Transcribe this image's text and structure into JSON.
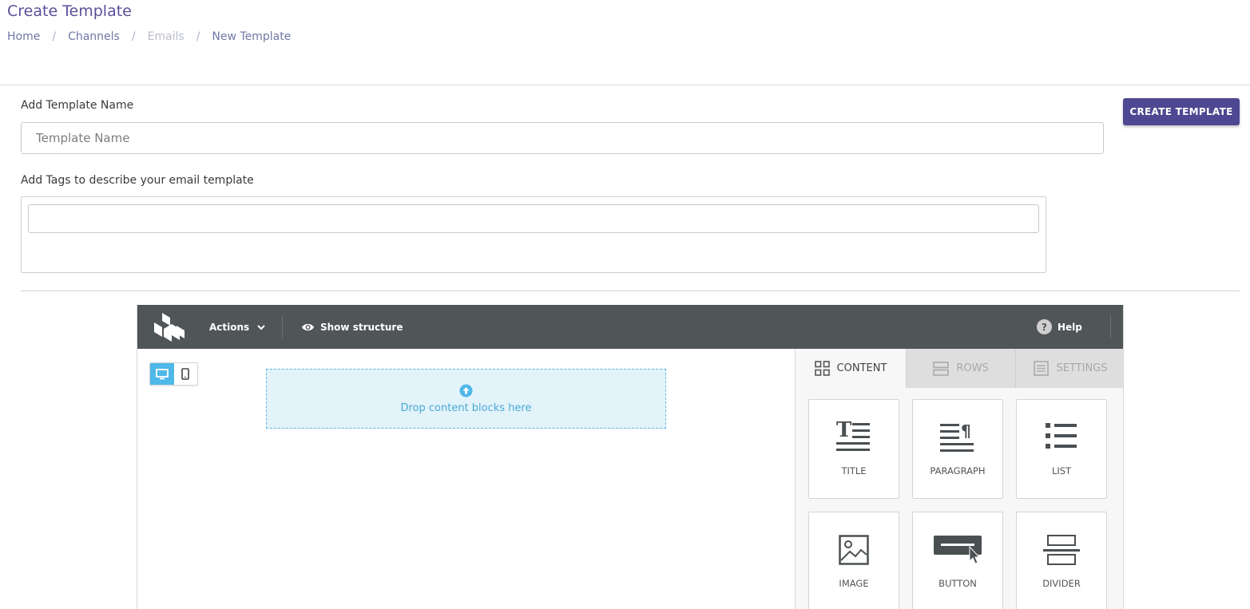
{
  "header": {
    "title": "Create Template",
    "breadcrumb": [
      "Home",
      "Channels",
      "Emails",
      "New Template"
    ],
    "separator": "/"
  },
  "form": {
    "name_label": "Add Template Name",
    "name_placeholder": "Template Name",
    "name_value": "",
    "tags_label": "Add Tags to describe your email template",
    "tags_value": "",
    "create_button": "CREATE TEMPLATE"
  },
  "editor": {
    "toolbar": {
      "actions_label": "Actions",
      "show_structure_label": "Show structure",
      "help_label": "Help",
      "help_glyph": "?"
    },
    "device_toggle": {
      "active": "desktop"
    },
    "drop_zone_text": "Drop content blocks here",
    "sidebar": {
      "tabs": [
        {
          "label": "CONTENT",
          "icon": "grid-icon",
          "active": true
        },
        {
          "label": "ROWS",
          "icon": "rows-icon",
          "active": false
        },
        {
          "label": "SETTINGS",
          "icon": "settings-icon",
          "active": false
        }
      ],
      "blocks": [
        {
          "label": "TITLE",
          "icon": "title-icon"
        },
        {
          "label": "PARAGRAPH",
          "icon": "paragraph-icon"
        },
        {
          "label": "LIST",
          "icon": "list-icon"
        },
        {
          "label": "IMAGE",
          "icon": "image-icon"
        },
        {
          "label": "BUTTON",
          "icon": "button-icon"
        },
        {
          "label": "DIVIDER",
          "icon": "divider-icon"
        }
      ]
    }
  },
  "colors": {
    "title": "#5b4f9a",
    "primary_button": "#4e4791",
    "toolbar": "#505557",
    "accent": "#4eb8e8",
    "drop_zone_bg": "#e2f3fa"
  }
}
